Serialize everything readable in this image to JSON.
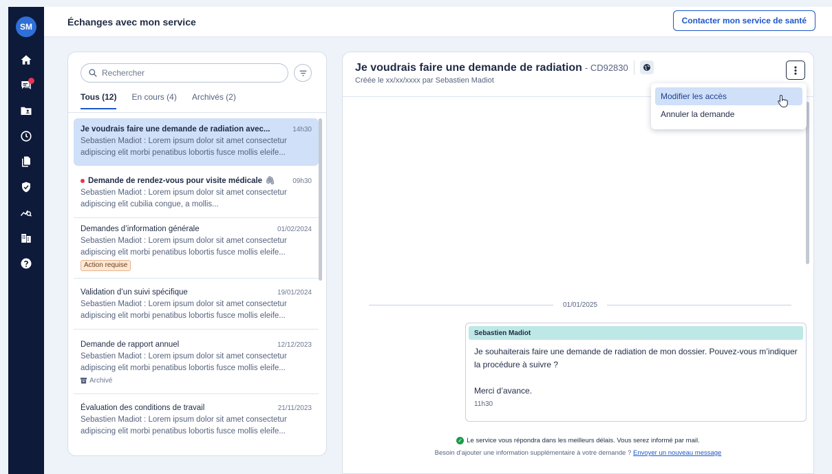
{
  "sidebar": {
    "avatar_initials": "SM",
    "items": [
      {
        "icon": "home-icon"
      },
      {
        "icon": "messages-icon",
        "notification": true
      },
      {
        "icon": "folder-icon"
      },
      {
        "icon": "clock-icon"
      },
      {
        "icon": "documents-icon"
      },
      {
        "icon": "shield-icon"
      },
      {
        "icon": "analytics-icon"
      },
      {
        "icon": "building-icon"
      },
      {
        "icon": "help-icon"
      }
    ]
  },
  "header": {
    "title": "Échanges avec mon service",
    "contact_button": "Contacter mon service de santé"
  },
  "list": {
    "search_placeholder": "Rechercher",
    "tabs": [
      "Tous (12)",
      "En cours (4)",
      "Archivés (2)"
    ],
    "items": [
      {
        "title": "Je voudrais faire une demande de radiation avec...",
        "time": "14h30",
        "snippet": "Sebastien Madiot : Lorem ipsum dolor sit amet consectetur adipiscing elit morbi penatibus lobortis fusce mollis eleife..."
      },
      {
        "title": "Demande de rendez-vous pour visite médicale",
        "time": "09h30",
        "snippet": "Sebastien Madiot : Lorem ipsum dolor sit amet consectetur adipiscing elit cubilia congue, a mollis..."
      },
      {
        "title": "Demandes d’information générale",
        "time": "01/02/2024",
        "snippet": "Sebastien Madiot : Lorem ipsum dolor sit amet consectetur adipiscing elit morbi penatibus lobortis fusce mollis eleife...",
        "badge": "Action requise"
      },
      {
        "title": "Validation d’un suivi spécifique",
        "time": "19/01/2024",
        "snippet": "Sebastien Madiot : Lorem ipsum dolor sit amet consectetur adipiscing elit morbi penatibus lobortis fusce mollis eleife..."
      },
      {
        "title": "Demande de rapport annuel",
        "time": "12/12/2023",
        "snippet": "Sebastien Madiot : Lorem ipsum dolor sit amet consectetur adipiscing elit morbi penatibus lobortis fusce mollis eleife...",
        "badge": "Archivé"
      },
      {
        "title": "Évaluation des conditions de travail",
        "time": "21/11/2023",
        "snippet": "Sebastien Madiot : Lorem ipsum dolor sit amet consectetur adipiscing elit morbi penatibus lobortis fusce mollis eleife..."
      }
    ]
  },
  "chat": {
    "title": "Je voudrais faire une demande de radiation",
    "ref": "- CD92830",
    "subtitle": "Créée le xx/xx/xxxx par Sebastien Madiot",
    "menu": [
      "Modifier les accès",
      "Annuler la demande"
    ],
    "date_separator": "01/01/2025",
    "message": {
      "author": "Sebastien Madiot",
      "body1": "Je souhaiterais faire une demande de radiation de mon dossier. Pouvez-vous m’indiquer la procédure à suivre ?",
      "body2": "Merci d’avance.",
      "time": "11h30"
    },
    "info_line": "Le service vous répondra dans les meilleurs délais. Vous serez informé par mail.",
    "info_question": "Besoin d’ajouter une information supplémentaire à votre demande ?",
    "info_link": "Envoyer un nouveau message"
  }
}
